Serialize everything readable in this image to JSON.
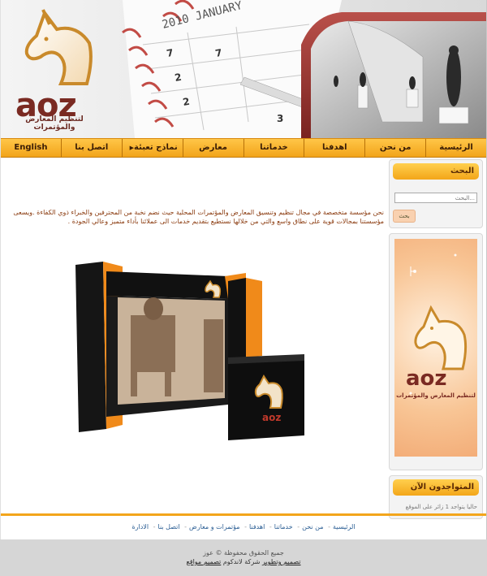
{
  "brand": {
    "logo_text": "aoz",
    "logo_subtitle": "لتنظيم المعارض والمؤتمرات"
  },
  "header": {
    "calendar_text": "2010 JANUARY"
  },
  "nav": {
    "items": [
      {
        "label": "الرئيسية"
      },
      {
        "label": "من نحن"
      },
      {
        "label": "اهدفنا"
      },
      {
        "label": "خدماتنا"
      },
      {
        "label": "معارض"
      },
      {
        "label": "نماذج تعبئة"
      },
      {
        "label": "اتصل بنا"
      },
      {
        "label": "English"
      }
    ]
  },
  "sidebar": {
    "search": {
      "title": "البحث",
      "placeholder": "البحث...",
      "button": "بحث"
    },
    "online": {
      "title": "المتواجدون الآن",
      "text": "حاليا يتواجد 1 زائر على الموقع"
    }
  },
  "content": {
    "paragraph": "نحن مؤسسة متخصصة في مجال تنظيم وتنسيق المعارض والمؤتمرات المحلية حيث نضم نخبة من المحترفين والخبراء ذوي الكفاءة .ويسعى مؤسستنا بمجالات قوية على نطاق واسع والتي من خلالها نستطيع بتقديم خدمات الى عملائنا بأداء متميز وعالي الجودة ."
  },
  "footer": {
    "links": [
      "الرئيسية",
      "من نحن",
      "خدماتنا",
      "اهدفنا",
      "مؤتمرات و معارض",
      "اتصل بنا",
      "الادارة"
    ],
    "copyright": "جميع الحقوق محفوظة © عوز",
    "credits_prefix": "تصميم وتطوير",
    "credits_company": "شركة لاندكوم",
    "credits_suffix": "تصميم مواقع"
  },
  "colors": {
    "accent": "#f3a519",
    "brown": "#7a2a22",
    "link": "#2b5e94"
  }
}
